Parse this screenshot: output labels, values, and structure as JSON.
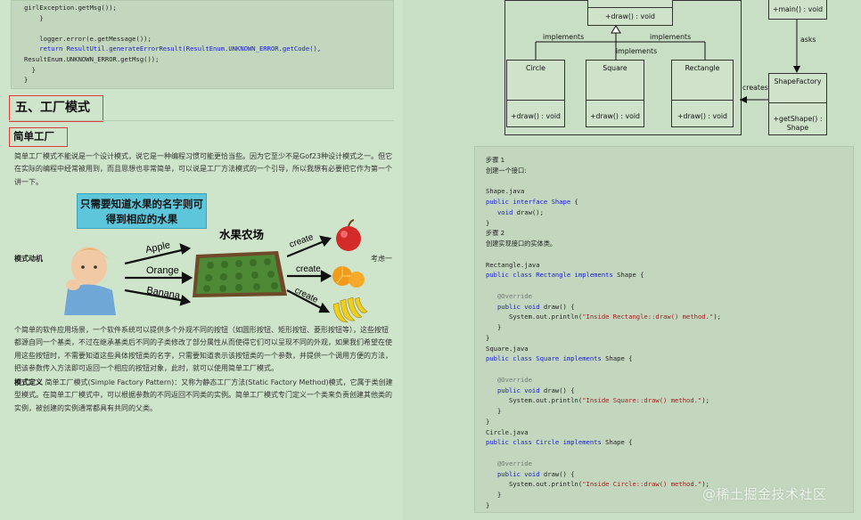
{
  "left": {
    "code_top": [
      "girlException.getMsg());",
      "    }",
      "",
      "    logger.error(e.getMessage());",
      "    return ResultUtil.generateErrorResult(ResultEnum.UNKNOWN_ERROR.getCode(),",
      "ResultEnum.UNKNOWN_ERROR.getMsg());",
      "  }",
      "}"
    ],
    "heading_section": "五、工厂模式",
    "heading_sub": "简单工厂",
    "para1": "简单工厂模式不能说是一个设计模式，说它是一种编程习惯可能更恰当些。因为它至少不是Gof23种设计模式之一。但它在实际的编程中经常被用到，而且思想也非常简单，可以说是工厂方法模式的一个引导，所以我想有必要把它作为第一个讲一下。",
    "illustration": {
      "banner": "只需要知道水果的名字则可得到相应的水果",
      "farm_title": "水果农场",
      "fruit_labels": [
        "Apple",
        "Orange",
        "Banana"
      ],
      "create_labels": [
        "create",
        "create",
        "create"
      ]
    },
    "label_mode": "模式动机",
    "label_think": "考虑一",
    "para2": "个简单的软件应用场景，一个软件系统可以提供多个外观不同的按钮（如圆形按钮、矩形按钮、菱形按钮等），这些按钮都源自同一个基类，不过在继承基类后不同的子类修改了部分属性从而使得它们可以呈现不同的外观，如果我们希望在使用这些按钮时，不需要知道这些具体按钮类的名字，只需要知道表示该按钮类的一个参数，并提供一个调用方便的方法，把该参数传入方法即可返回一个相应的按钮对象，此时，就可以使用简单工厂模式。",
    "para3_bold": "模式定义",
    "para3": " 简单工厂模式(Simple Factory Pattern)：又称为静态工厂方法(Static Factory Method)模式，它属于类创建型模式。在简单工厂模式中，可以根据参数的不同返回不同类的实例。简单工厂模式专门定义一个类来负责创建其他类的实例，被创建的实例通常都具有共同的父类。"
  },
  "uml": {
    "shape_op": "+draw() : void",
    "main_op": "+main() : void",
    "implements": [
      "implements",
      "implements",
      "implements"
    ],
    "asks": "asks",
    "creates": "creates",
    "circle": "Circle",
    "square": "Square",
    "rectangle": "Rectangle",
    "circle_op": "+draw() : void",
    "square_op": "+draw() : void",
    "rectangle_op": "+draw() : void",
    "factory": "ShapeFactory",
    "factory_op": "+getShape() :\nShape"
  },
  "right_code": {
    "step1": "步骤 1",
    "step1_desc": "创建一个接口:",
    "file_shape": "Shape.java",
    "step2": "步骤 2",
    "step2_desc": "创建实现接口的实体类。",
    "file_rect": "Rectangle.java",
    "file_square": "Square.java",
    "file_circle": "Circle.java",
    "msg_rect": "\"Inside Rectangle::draw() method.\"",
    "msg_square": "\"Inside Square::draw() method.\"",
    "msg_circle": "\"Inside Circle::draw() method.\""
  },
  "watermark": "@稀土掘金技术社区"
}
